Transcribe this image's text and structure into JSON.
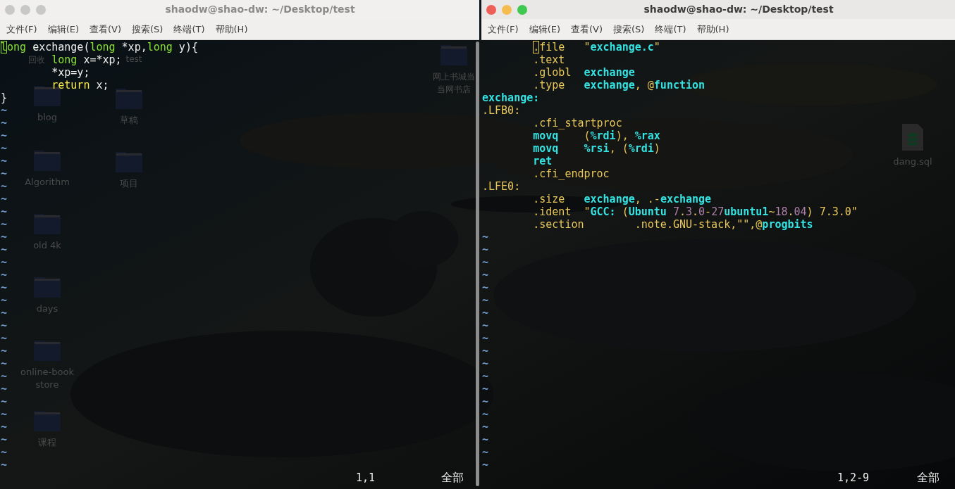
{
  "desktop": {
    "icons": [
      {
        "label": "回收",
        "kind": "hidden"
      },
      {
        "label": "test",
        "kind": "hidden"
      },
      {
        "label": "blog",
        "kind": "folder"
      },
      {
        "label": "草稿",
        "kind": "folder"
      },
      {
        "label": "Algorithm",
        "kind": "folder"
      },
      {
        "label": "项目",
        "kind": "folder"
      },
      {
        "label": "old 4k",
        "kind": "folder"
      },
      {
        "label": "days",
        "kind": "folder"
      },
      {
        "label": "online-bookstore",
        "kind": "folder"
      },
      {
        "label": "课程",
        "kind": "folder"
      },
      {
        "label": "网上书城当当网书店",
        "kind": "folder"
      },
      {
        "label": "dang.sql",
        "kind": "database-file"
      }
    ]
  },
  "windows": [
    {
      "title": "shaodw@shao-dw: ~/Desktop/test",
      "active": false,
      "menu": [
        "文件(F)",
        "编辑(E)",
        "查看(V)",
        "搜索(S)",
        "终端(T)",
        "帮助(H)"
      ],
      "lines": [
        {
          "cursor": true,
          "tokens": [
            {
              "t": "long",
              "kind": "type"
            },
            {
              "t": " exchange(",
              "kind": "plain"
            },
            {
              "t": "long",
              "kind": "type"
            },
            {
              "t": " *xp,",
              "kind": "plain"
            },
            {
              "t": "long",
              "kind": "type"
            },
            {
              "t": " y){",
              "kind": "plain"
            }
          ]
        },
        {
          "cursor": false,
          "tokens": [
            {
              "t": "        long",
              "kind": "type"
            },
            {
              "t": " x=*xp;",
              "kind": "plain"
            }
          ]
        },
        {
          "cursor": false,
          "tokens": [
            {
              "t": "        *xp=y;",
              "kind": "plain"
            }
          ]
        },
        {
          "cursor": false,
          "tokens": [
            {
              "t": "        return",
              "kind": "statement"
            },
            {
              "t": " x;",
              "kind": "plain"
            }
          ]
        },
        {
          "cursor": false,
          "tokens": [
            {
              "t": "}",
              "kind": "plain"
            }
          ]
        }
      ],
      "filler": [
        "~",
        "~",
        "~",
        "~",
        "~",
        "~",
        "~",
        "~",
        "~",
        "~",
        "~",
        "~",
        "~",
        "~",
        "~",
        "~",
        "~",
        "~",
        "~",
        "~",
        "~",
        "~",
        "~",
        "~",
        "~",
        "~",
        "~",
        "~",
        "~"
      ],
      "ruler": "1,1",
      "position": "全部"
    },
    {
      "title": "shaodw@shao-dw: ~/Desktop/test",
      "active": true,
      "menu": [
        "文件(F)",
        "编辑(E)",
        "查看(V)",
        "搜索(S)",
        "终端(T)",
        "帮助(H)"
      ],
      "lines": [
        {
          "cursor": true,
          "tokens": [
            {
              "t": "        .file   \"",
              "kind": "directive"
            },
            {
              "t": "exchange.c",
              "kind": "ident"
            },
            {
              "t": "\"",
              "kind": "directive"
            }
          ]
        },
        {
          "cursor": false,
          "tokens": [
            {
              "t": "        .text",
              "kind": "directive"
            }
          ]
        },
        {
          "cursor": false,
          "tokens": [
            {
              "t": "        .globl  ",
              "kind": "directive"
            },
            {
              "t": "exchange",
              "kind": "ident"
            }
          ]
        },
        {
          "cursor": false,
          "tokens": [
            {
              "t": "        .type   ",
              "kind": "directive"
            },
            {
              "t": "exchange",
              "kind": "ident"
            },
            {
              "t": ", @",
              "kind": "directive"
            },
            {
              "t": "function",
              "kind": "ident"
            }
          ]
        },
        {
          "cursor": false,
          "tokens": [
            {
              "t": "exchange:",
              "kind": "ident"
            }
          ]
        },
        {
          "cursor": false,
          "tokens": [
            {
              "t": ".LFB0:",
              "kind": "directive"
            }
          ]
        },
        {
          "cursor": false,
          "tokens": [
            {
              "t": "        .cfi_startproc",
              "kind": "directive"
            }
          ]
        },
        {
          "cursor": false,
          "tokens": [
            {
              "t": "        movq",
              "kind": "ident"
            },
            {
              "t": "    (",
              "kind": "directive"
            },
            {
              "t": "%rdi",
              "kind": "ident"
            },
            {
              "t": "), ",
              "kind": "directive"
            },
            {
              "t": "%rax",
              "kind": "ident"
            }
          ]
        },
        {
          "cursor": false,
          "tokens": [
            {
              "t": "        movq",
              "kind": "ident"
            },
            {
              "t": "    %rsi",
              "kind": "ident"
            },
            {
              "t": ", (",
              "kind": "directive"
            },
            {
              "t": "%rdi",
              "kind": "ident"
            },
            {
              "t": ")",
              "kind": "directive"
            }
          ]
        },
        {
          "cursor": false,
          "tokens": [
            {
              "t": "        ret",
              "kind": "ident"
            }
          ]
        },
        {
          "cursor": false,
          "tokens": [
            {
              "t": "        .cfi_endproc",
              "kind": "directive"
            }
          ]
        },
        {
          "cursor": false,
          "tokens": [
            {
              "t": ".LFE0:",
              "kind": "directive"
            }
          ]
        },
        {
          "cursor": false,
          "tokens": [
            {
              "t": "        .size   ",
              "kind": "directive"
            },
            {
              "t": "exchange",
              "kind": "ident"
            },
            {
              "t": ", .-",
              "kind": "directive"
            },
            {
              "t": "exchange",
              "kind": "ident"
            }
          ]
        },
        {
          "cursor": false,
          "tokens": [
            {
              "t": "        .ident  \"",
              "kind": "directive"
            },
            {
              "t": "GCC:",
              "kind": "ident"
            },
            {
              "t": " (",
              "kind": "directive"
            },
            {
              "t": "Ubuntu ",
              "kind": "ident"
            },
            {
              "t": "7",
              "kind": "number"
            },
            {
              "t": ".",
              "kind": "directive"
            },
            {
              "t": "3",
              "kind": "number"
            },
            {
              "t": ".",
              "kind": "directive"
            },
            {
              "t": "0",
              "kind": "number"
            },
            {
              "t": "-",
              "kind": "directive"
            },
            {
              "t": "27",
              "kind": "number"
            },
            {
              "t": "ubuntu1",
              "kind": "ident"
            },
            {
              "t": "~",
              "kind": "directive"
            },
            {
              "t": "18",
              "kind": "number"
            },
            {
              "t": ".",
              "kind": "directive"
            },
            {
              "t": "04",
              "kind": "number"
            },
            {
              "t": ") 7.3.0\"",
              "kind": "directive"
            }
          ]
        },
        {
          "cursor": false,
          "tokens": [
            {
              "t": "        .section        .note.GNU-stack,\"\",@",
              "kind": "directive"
            },
            {
              "t": "progbits",
              "kind": "ident"
            }
          ]
        }
      ],
      "filler": [
        "~",
        "~",
        "~",
        "~",
        "~",
        "~",
        "~",
        "~",
        "~",
        "~",
        "~",
        "~",
        "~",
        "~",
        "~",
        "~",
        "~",
        "~",
        "~"
      ],
      "ruler": "1,2-9",
      "position": "全部"
    }
  ]
}
